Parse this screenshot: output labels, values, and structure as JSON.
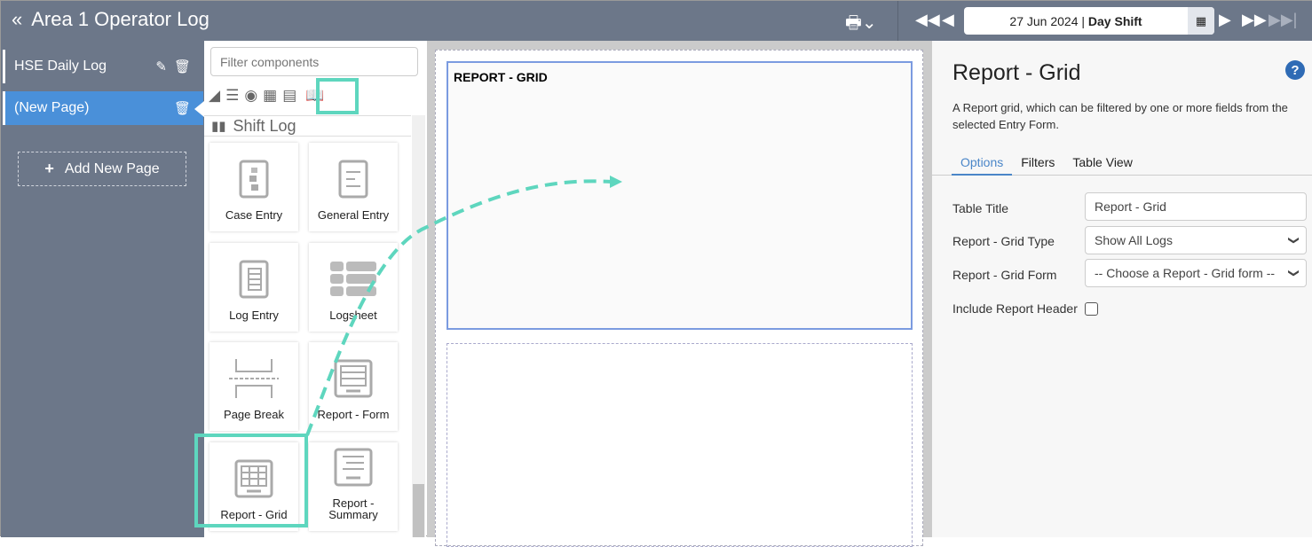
{
  "header": {
    "title": "Area 1 Operator Log",
    "date": "27 Jun 2024",
    "separator": "|",
    "shift": "Day Shift"
  },
  "sidebar": {
    "pages": [
      {
        "label": "HSE Daily Log"
      },
      {
        "label": "(New Page)"
      }
    ],
    "add_label": "Add New Page"
  },
  "components": {
    "filter_placeholder": "Filter components",
    "section": "Shift Log",
    "tiles": [
      {
        "label": "Case Entry"
      },
      {
        "label": "General Entry"
      },
      {
        "label": "Log Entry"
      },
      {
        "label": "Logsheet"
      },
      {
        "label": "Page Break"
      },
      {
        "label": "Report - Form"
      },
      {
        "label": "Report - Grid"
      },
      {
        "label": "Report - Summary"
      }
    ]
  },
  "canvas": {
    "widget_title": "REPORT - GRID"
  },
  "properties": {
    "title": "Report - Grid",
    "description": "A Report grid, which can be filtered by one or more fields from the selected Entry Form.",
    "tabs": [
      {
        "label": "Options"
      },
      {
        "label": "Filters"
      },
      {
        "label": "Table View"
      }
    ],
    "fields": {
      "table_title_label": "Table Title",
      "table_title_value": "Report - Grid",
      "type_label": "Report - Grid Type",
      "type_value": "Show All Logs",
      "form_label": "Report - Grid Form",
      "form_value": "-- Choose a Report - Grid form --",
      "header_label": "Include Report Header"
    }
  },
  "colors": {
    "accent": "#5ed6be",
    "header": "#6c7789",
    "active": "#4a90d9"
  }
}
